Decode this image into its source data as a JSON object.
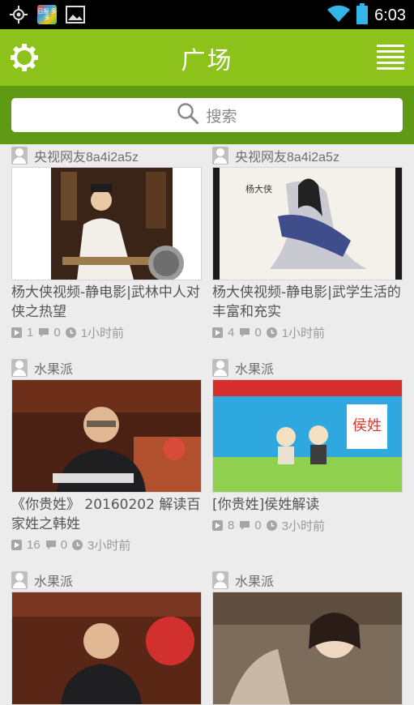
{
  "status_bar": {
    "time": "6:03",
    "app_badge": "日报 多多"
  },
  "header": {
    "title": "广场"
  },
  "search": {
    "placeholder": "搜索"
  },
  "videos": [
    {
      "user": "央视网友8a4i2a5z",
      "title": "杨大侠视频-静电影|武林中人对侠之热望",
      "plays": "1",
      "comments": "0",
      "time": "1小时前",
      "thumb": "costume-instrument"
    },
    {
      "user": "央视网友8a4i2a5z",
      "title": "杨大侠视频-静电影|武学生活的丰富和充实",
      "plays": "4",
      "comments": "0",
      "time": "1小时前",
      "thumb": "ink-painting"
    },
    {
      "user": "水果派",
      "title": "《你贵姓》 20160202 解读百家姓之韩姓",
      "plays": "16",
      "comments": "0",
      "time": "3小时前",
      "thumb": "tv-studio"
    },
    {
      "user": "水果派",
      "title": "[你贵姓]侯姓解读",
      "plays": "8",
      "comments": "0",
      "time": "3小时前",
      "thumb": "cartoon"
    },
    {
      "user": "水果派",
      "title": "",
      "plays": "",
      "comments": "",
      "time": "",
      "thumb": "tv-studio-2"
    },
    {
      "user": "水果派",
      "title": "",
      "plays": "",
      "comments": "",
      "time": "",
      "thumb": "drama"
    }
  ]
}
